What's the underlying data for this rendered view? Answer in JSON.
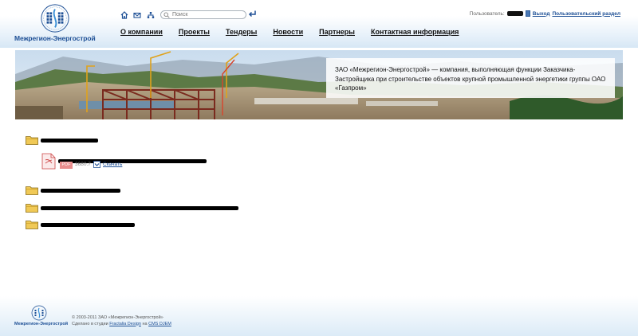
{
  "brand": {
    "logo_text": "Межрегион-Энергострой",
    "accent_color": "#1d4f95"
  },
  "toolbar": {
    "icons": [
      "home-icon",
      "mail-icon",
      "sitemap-icon"
    ],
    "search_placeholder": "Поиск",
    "submit_icon": "enter-arrow-icon"
  },
  "user_bar": {
    "label": "Пользователь:",
    "logout_label": "Выход",
    "personal_label": "Пользовательский раздел"
  },
  "nav": {
    "items": [
      {
        "label": "О компании"
      },
      {
        "label": "Проекты"
      },
      {
        "label": "Тендеры"
      },
      {
        "label": "Новости"
      },
      {
        "label": "Партнеры"
      },
      {
        "label": "Контактная информация"
      }
    ]
  },
  "banner": {
    "caption": "ЗАО «Межрегион-Энергострой» — компания, выполняющая функции Заказчика-Застройщика при строительстве объектов крупной промышленной энергетики группы ОАО «Газпром»"
  },
  "content": {
    "file": {
      "type_badge": "PDF",
      "size": "3680.7",
      "download_label": "Скачать"
    }
  },
  "footer": {
    "logo_text": "Межрегион-Энергострой",
    "copyright": "© 2003-2011 ЗАО «Межрегион-Энергострой»",
    "made_prefix": "Сделано в студии",
    "studio_link": "Fractalia Design",
    "on_word": "на",
    "cms_link": "CMS DJEM"
  }
}
